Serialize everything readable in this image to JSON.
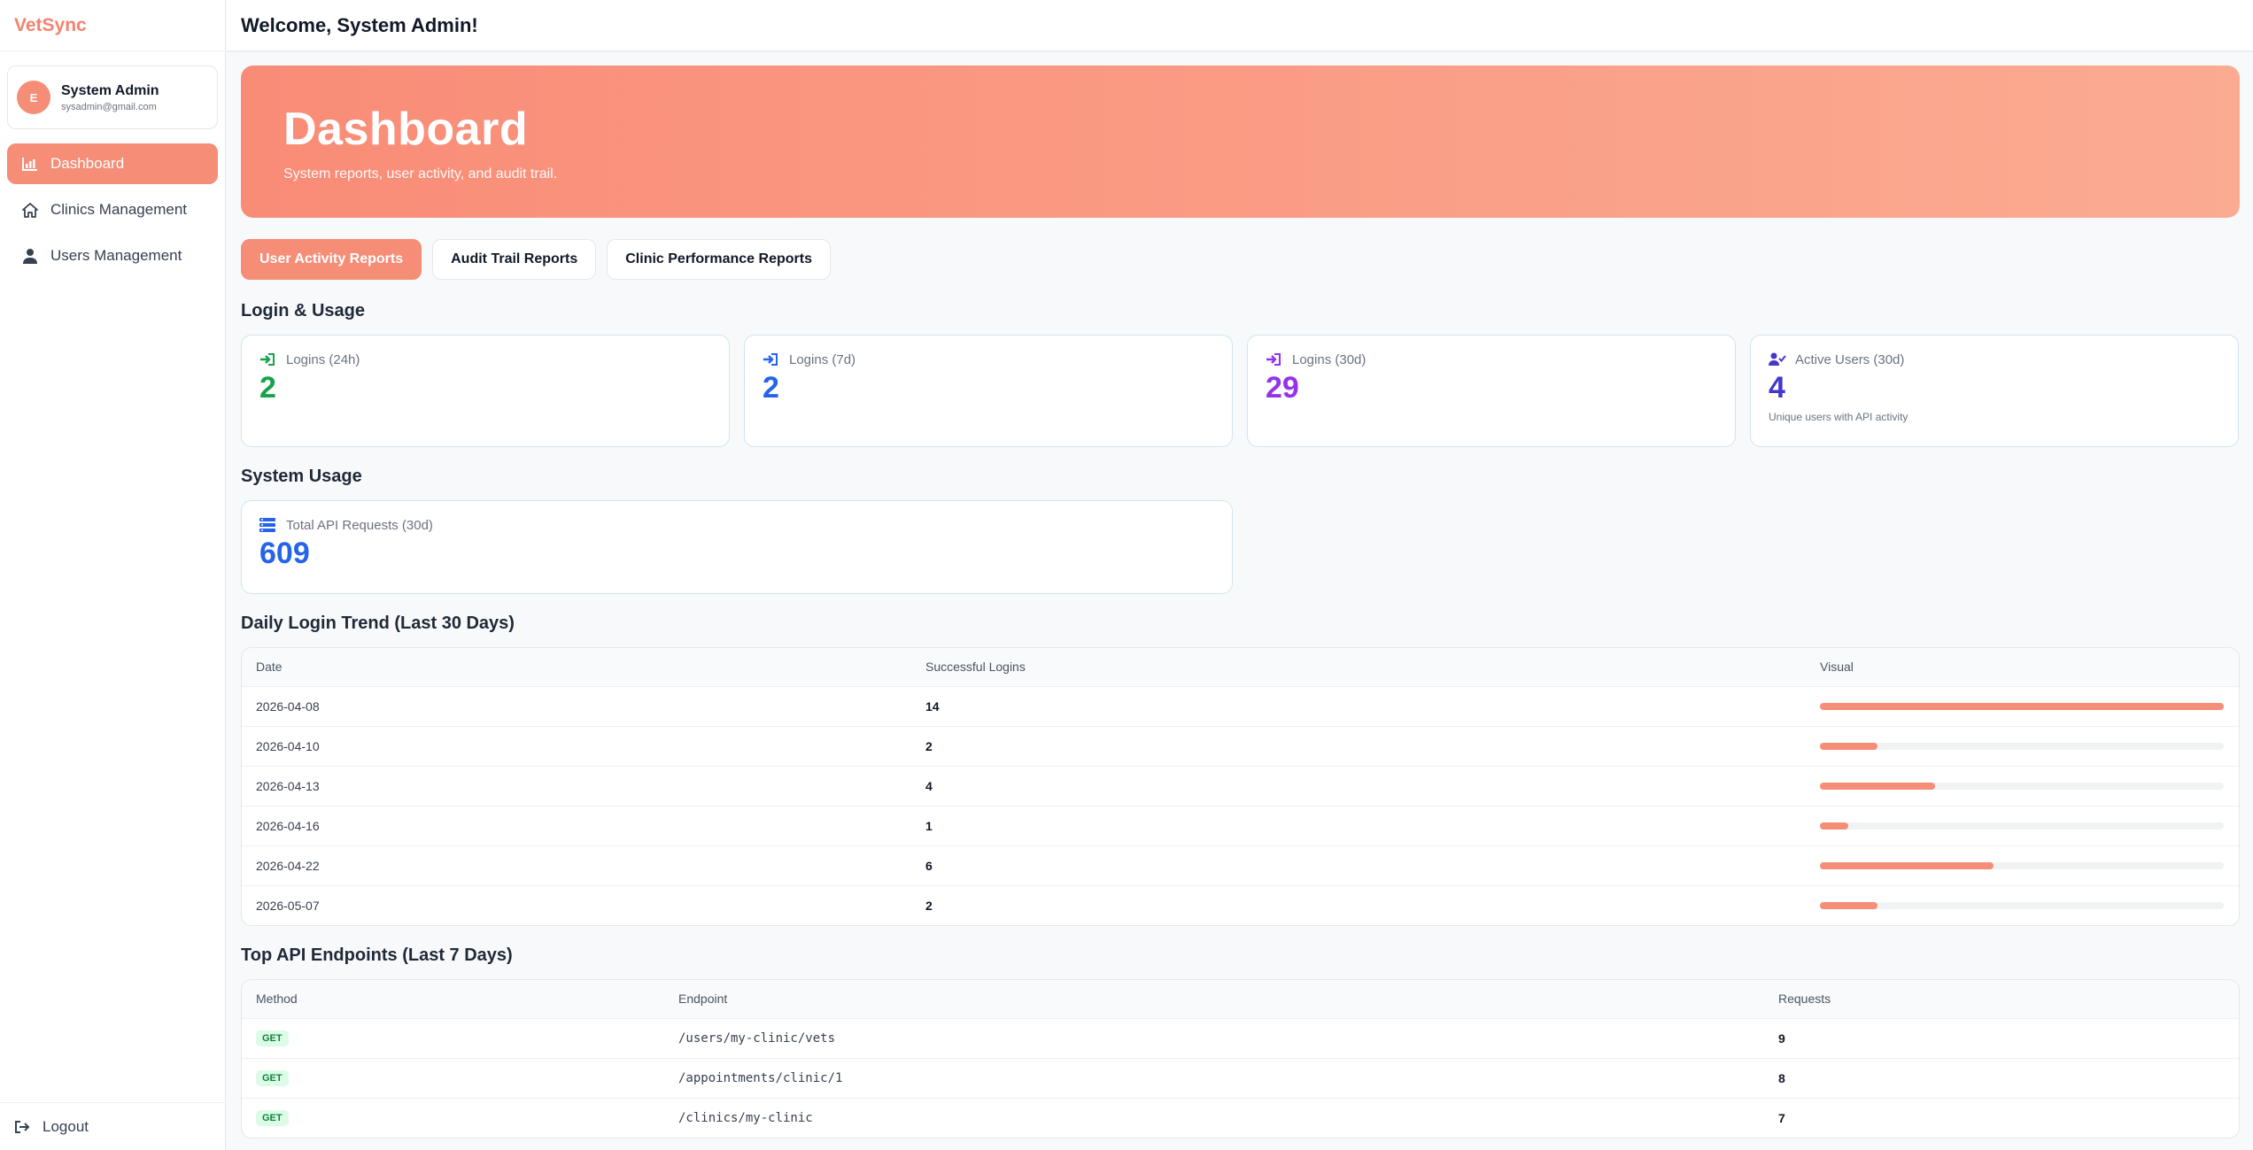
{
  "brand": "VetSync",
  "profile": {
    "initial": "E",
    "name": "System Admin",
    "email": "sysadmin@gmail.com"
  },
  "nav": [
    {
      "label": "Dashboard",
      "icon": "chart-icon"
    },
    {
      "label": "Clinics Management",
      "icon": "home-icon"
    },
    {
      "label": "Users Management",
      "icon": "user-icon"
    }
  ],
  "logout": "Logout",
  "topbar": {
    "welcome": "Welcome, System Admin!"
  },
  "hero": {
    "title": "Dashboard",
    "subtitle": "System reports, user activity, and audit trail."
  },
  "tabs": [
    "User Activity Reports",
    "Audit Trail Reports",
    "Clinic Performance Reports"
  ],
  "login_usage": {
    "title": "Login & Usage",
    "cards": [
      {
        "label": "Logins (24h)",
        "value": "2",
        "color": "#16a34a",
        "icon": "login-icon"
      },
      {
        "label": "Logins (7d)",
        "value": "2",
        "color": "#2563eb",
        "icon": "login-icon"
      },
      {
        "label": "Logins (30d)",
        "value": "29",
        "color": "#9333ea",
        "icon": "login-icon"
      },
      {
        "label": "Active Users (30d)",
        "value": "4",
        "color": "#4338ca",
        "icon": "user-check-icon",
        "sub": "Unique users with API activity"
      }
    ]
  },
  "system_usage": {
    "title": "System Usage",
    "card": {
      "label": "Total API Requests (30d)",
      "value": "609",
      "color": "#2563eb",
      "icon": "server-icon"
    }
  },
  "daily_login": {
    "title": "Daily Login Trend (Last 30 Days)",
    "headers": [
      "Date",
      "Successful Logins",
      "Visual"
    ],
    "rows": [
      {
        "date": "2026-04-08",
        "logins": "14",
        "fill": 1.0
      },
      {
        "date": "2026-04-10",
        "logins": "2",
        "fill": 0.143
      },
      {
        "date": "2026-04-13",
        "logins": "4",
        "fill": 0.286
      },
      {
        "date": "2026-04-16",
        "logins": "1",
        "fill": 0.071
      },
      {
        "date": "2026-04-22",
        "logins": "6",
        "fill": 0.429
      },
      {
        "date": "2026-05-07",
        "logins": "2",
        "fill": 0.143
      }
    ]
  },
  "top_api": {
    "title": "Top API Endpoints (Last 7 Days)",
    "headers": [
      "Method",
      "Endpoint",
      "Requests"
    ],
    "rows": [
      {
        "method": "GET",
        "endpoint": "/users/my-clinic/vets",
        "requests": "9"
      },
      {
        "method": "GET",
        "endpoint": "/appointments/clinic/1",
        "requests": "8"
      },
      {
        "method": "GET",
        "endpoint": "/clinics/my-clinic",
        "requests": "7"
      }
    ]
  }
}
